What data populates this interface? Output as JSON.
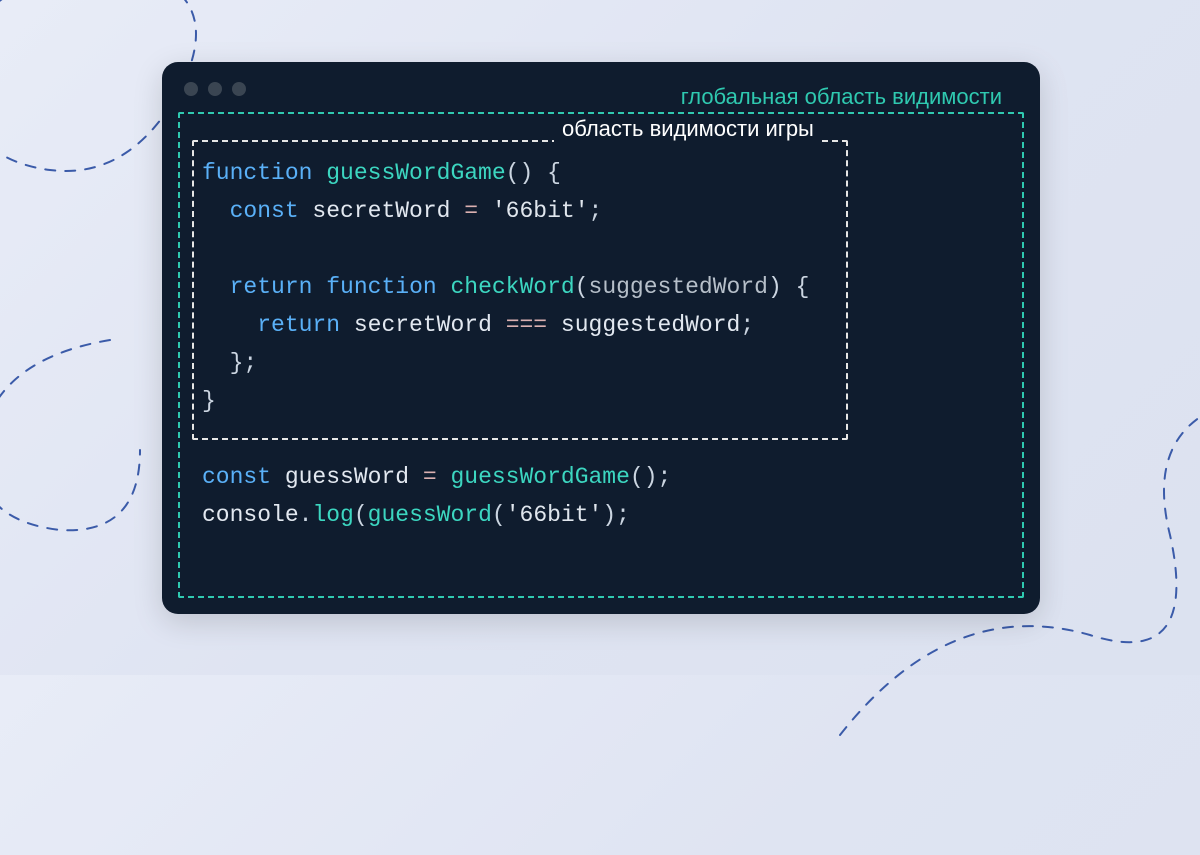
{
  "labels": {
    "global_scope": "глобальная область видимости",
    "game_scope": "область видимости  игры"
  },
  "code": {
    "l1": {
      "kw_function": "function",
      "fn": "guessWordGame",
      "parens": "()",
      "brace_open": " {"
    },
    "l2": {
      "indent": "  ",
      "kw_const": "const",
      "name": " secretWord ",
      "op_assign": "=",
      "str": " '66bit'",
      "semi": ";"
    },
    "l3": {
      "blank": ""
    },
    "l4": {
      "indent": "  ",
      "kw_return": "return",
      "sp": " ",
      "kw_function": "function",
      "fn": " checkWord",
      "paren_open": "(",
      "param": "suggestedWord",
      "paren_close": ")",
      "brace_open": " {"
    },
    "l5": {
      "indent": "    ",
      "kw_return": "return",
      "name1": " secretWord ",
      "op_eq": "===",
      "name2": " suggestedWord",
      "semi": ";"
    },
    "l6": {
      "indent": "  ",
      "brace_close": "};"
    },
    "l7": {
      "brace_close": "}"
    },
    "l8": {
      "blank": ""
    },
    "l9": {
      "kw_const": "const",
      "name": " guessWord ",
      "op_assign": "=",
      "sp": " ",
      "fn": "guessWordGame",
      "call": "();"
    },
    "l10": {
      "obj": "console",
      "dot": ".",
      "method": "log",
      "paren_open": "(",
      "fn": "guessWord",
      "paren_open2": "(",
      "str": "'66bit'",
      "paren_close": ");"
    }
  }
}
